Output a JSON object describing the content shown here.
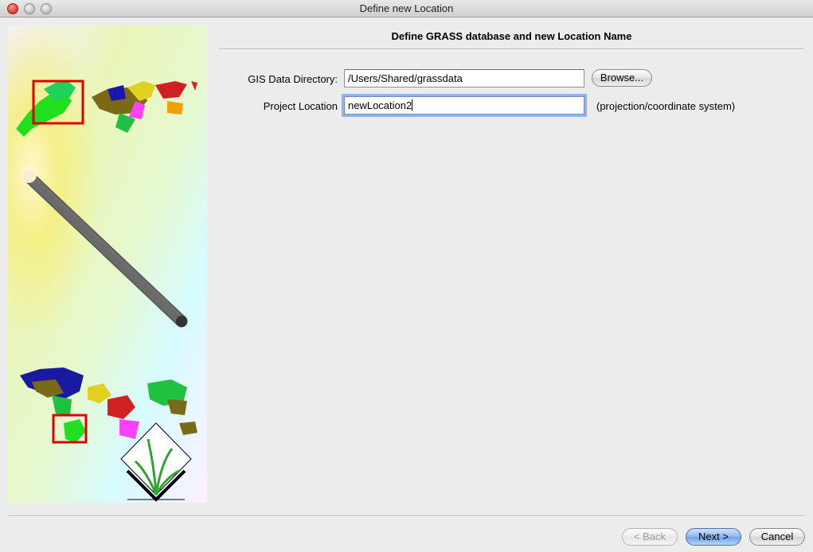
{
  "window": {
    "title": "Define new Location"
  },
  "header": {
    "title": "Define GRASS database and new Location Name"
  },
  "form": {
    "gis_dir_label": "GIS Data Directory:",
    "gis_dir_value": "/Users/Shared/grassdata",
    "browse_label": "Browse...",
    "location_label": "Project Location",
    "location_value": "newLocation2",
    "location_hint": "(projection/coordinate system)"
  },
  "footer": {
    "back_label": "< Back",
    "next_label": "Next >",
    "cancel_label": "Cancel"
  },
  "colors": {
    "accent": "#6ea1e7",
    "highlight_box": "#e00000",
    "grass_green": "#2fa52f"
  }
}
